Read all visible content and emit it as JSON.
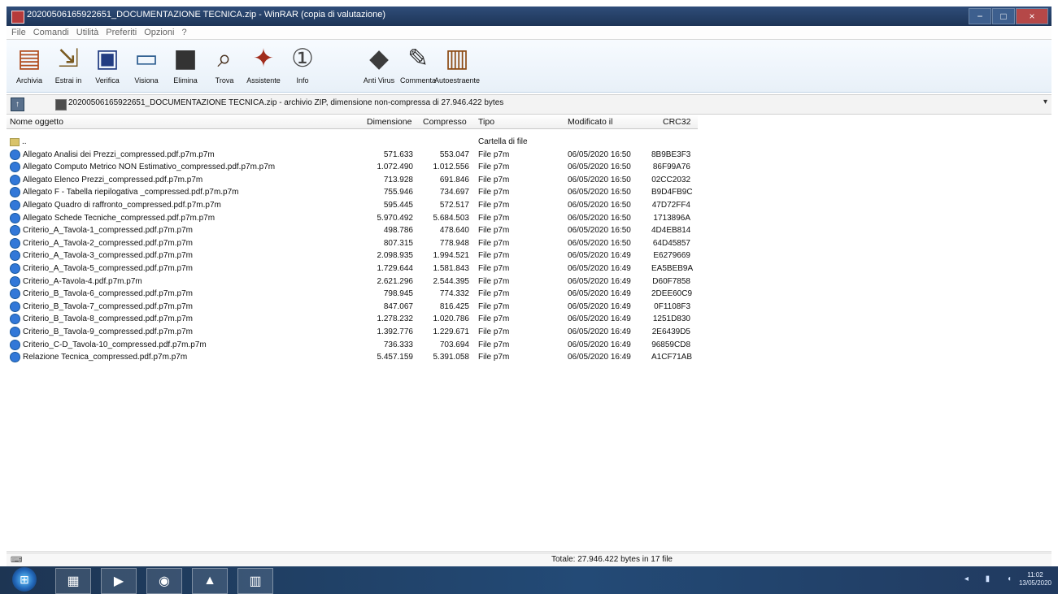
{
  "window": {
    "title": "20200506165922651_DOCUMENTAZIONE TECNICA.zip - WinRAR (copia di valutazione)"
  },
  "menu": [
    "File",
    "Comandi",
    "Utilità",
    "Preferiti",
    "Opzioni",
    "?"
  ],
  "toolbar": {
    "buttons": [
      {
        "label": "Archivia",
        "icon": "archive-icon",
        "glyph": "▤",
        "color": "#b04b1c"
      },
      {
        "label": "Estrai in",
        "icon": "extract-icon",
        "glyph": "⇲",
        "color": "#7a5a20"
      },
      {
        "label": "Verifica",
        "icon": "verify-icon",
        "glyph": "▣",
        "color": "#233d82"
      },
      {
        "label": "Visiona",
        "icon": "view-icon",
        "glyph": "▭",
        "color": "#2f5f91"
      },
      {
        "label": "Elimina",
        "icon": "delete-icon",
        "glyph": "■",
        "color": "#333333"
      },
      {
        "label": "Trova",
        "icon": "find-icon",
        "glyph": "⌕",
        "color": "#4c3523"
      },
      {
        "label": "Assistente",
        "icon": "wizard-icon",
        "glyph": "✦",
        "color": "#a12c1c"
      },
      {
        "label": "Info",
        "icon": "info-icon",
        "glyph": "①",
        "color": "#444444"
      },
      {
        "label": "Anti Virus",
        "icon": "antivirus-icon",
        "glyph": "◆",
        "color": "#3c3c3c"
      },
      {
        "label": "Commenta",
        "icon": "comment-icon",
        "glyph": "✎",
        "color": "#303030"
      },
      {
        "label": "Autoestraente",
        "icon": "sfx-icon",
        "glyph": "▥",
        "color": "#8d4b14"
      }
    ]
  },
  "address": {
    "path": "20200506165922651_DOCUMENTAZIONE TECNICA.zip - archivio ZIP, dimensione non-compressa di 27.946.422 bytes"
  },
  "columns": {
    "name": "Nome oggetto",
    "size": "Dimensione",
    "compressed": "Compresso",
    "type": "Tipo",
    "modified": "Modificato il",
    "crc": "CRC32"
  },
  "files": [
    {
      "name": "..",
      "size": "",
      "compressed": "",
      "type": "Cartella di file",
      "modified": "",
      "crc": ""
    },
    {
      "name": "Allegato Analisi dei Prezzi_compressed.pdf.p7m.p7m",
      "size": "571.633",
      "compressed": "553.047",
      "type": "File p7m",
      "modified": "06/05/2020 16:50",
      "crc": "8B9BE3F3"
    },
    {
      "name": "Allegato Computo Metrico NON Estimativo_compressed.pdf.p7m.p7m",
      "size": "1.072.490",
      "compressed": "1.012.556",
      "type": "File p7m",
      "modified": "06/05/2020 16:50",
      "crc": "86F99A76"
    },
    {
      "name": "Allegato Elenco Prezzi_compressed.pdf.p7m.p7m",
      "size": "713.928",
      "compressed": "691.846",
      "type": "File p7m",
      "modified": "06/05/2020 16:50",
      "crc": "02CC2032"
    },
    {
      "name": "Allegato F - Tabella riepilogativa _compressed.pdf.p7m.p7m",
      "size": "755.946",
      "compressed": "734.697",
      "type": "File p7m",
      "modified": "06/05/2020 16:50",
      "crc": "B9D4FB9C"
    },
    {
      "name": "Allegato Quadro di raffronto_compressed.pdf.p7m.p7m",
      "size": "595.445",
      "compressed": "572.517",
      "type": "File p7m",
      "modified": "06/05/2020 16:50",
      "crc": "47D72FF4"
    },
    {
      "name": "Allegato Schede Tecniche_compressed.pdf.p7m.p7m",
      "size": "5.970.492",
      "compressed": "5.684.503",
      "type": "File p7m",
      "modified": "06/05/2020 16:50",
      "crc": "1713896A"
    },
    {
      "name": "Criterio_A_Tavola-1_compressed.pdf.p7m.p7m",
      "size": "498.786",
      "compressed": "478.640",
      "type": "File p7m",
      "modified": "06/05/2020 16:50",
      "crc": "4D4EB814"
    },
    {
      "name": "Criterio_A_Tavola-2_compressed.pdf.p7m.p7m",
      "size": "807.315",
      "compressed": "778.948",
      "type": "File p7m",
      "modified": "06/05/2020 16:50",
      "crc": "64D45857"
    },
    {
      "name": "Criterio_A_Tavola-3_compressed.pdf.p7m.p7m",
      "size": "2.098.935",
      "compressed": "1.994.521",
      "type": "File p7m",
      "modified": "06/05/2020 16:49",
      "crc": "E6279669"
    },
    {
      "name": "Criterio_A_Tavola-5_compressed.pdf.p7m.p7m",
      "size": "1.729.644",
      "compressed": "1.581.843",
      "type": "File p7m",
      "modified": "06/05/2020 16:49",
      "crc": "EA5BEB9A"
    },
    {
      "name": "Criterio_A-Tavola-4.pdf.p7m.p7m",
      "size": "2.621.296",
      "compressed": "2.544.395",
      "type": "File p7m",
      "modified": "06/05/2020 16:49",
      "crc": "D60F7858"
    },
    {
      "name": "Criterio_B_Tavola-6_compressed.pdf.p7m.p7m",
      "size": "798.945",
      "compressed": "774.332",
      "type": "File p7m",
      "modified": "06/05/2020 16:49",
      "crc": "2DEE60C9"
    },
    {
      "name": "Criterio_B_Tavola-7_compressed.pdf.p7m.p7m",
      "size": "847.067",
      "compressed": "816.425",
      "type": "File p7m",
      "modified": "06/05/2020 16:49",
      "crc": "0F1108F3"
    },
    {
      "name": "Criterio_B_Tavola-8_compressed.pdf.p7m.p7m",
      "size": "1.278.232",
      "compressed": "1.020.786",
      "type": "File p7m",
      "modified": "06/05/2020 16:49",
      "crc": "1251D830"
    },
    {
      "name": "Criterio_B_Tavola-9_compressed.pdf.p7m.p7m",
      "size": "1.392.776",
      "compressed": "1.229.671",
      "type": "File p7m",
      "modified": "06/05/2020 16:49",
      "crc": "2E6439D5"
    },
    {
      "name": "Criterio_C-D_Tavola-10_compressed.pdf.p7m.p7m",
      "size": "736.333",
      "compressed": "703.694",
      "type": "File p7m",
      "modified": "06/05/2020 16:49",
      "crc": "96859CD8"
    },
    {
      "name": "Relazione Tecnica_compressed.pdf.p7m.p7m",
      "size": "5.457.159",
      "compressed": "5.391.058",
      "type": "File p7m",
      "modified": "06/05/2020 16:49",
      "crc": "A1CF71AB"
    }
  ],
  "status": {
    "total": "Totale: 27.946.422 bytes in 17 file"
  },
  "taskbar": {
    "apps": [
      "file-explorer-icon",
      "media-player-icon",
      "chrome-icon",
      "pdf-icon",
      "winrar-icon"
    ],
    "clock": [
      "11:02",
      "13/05/2020"
    ]
  }
}
